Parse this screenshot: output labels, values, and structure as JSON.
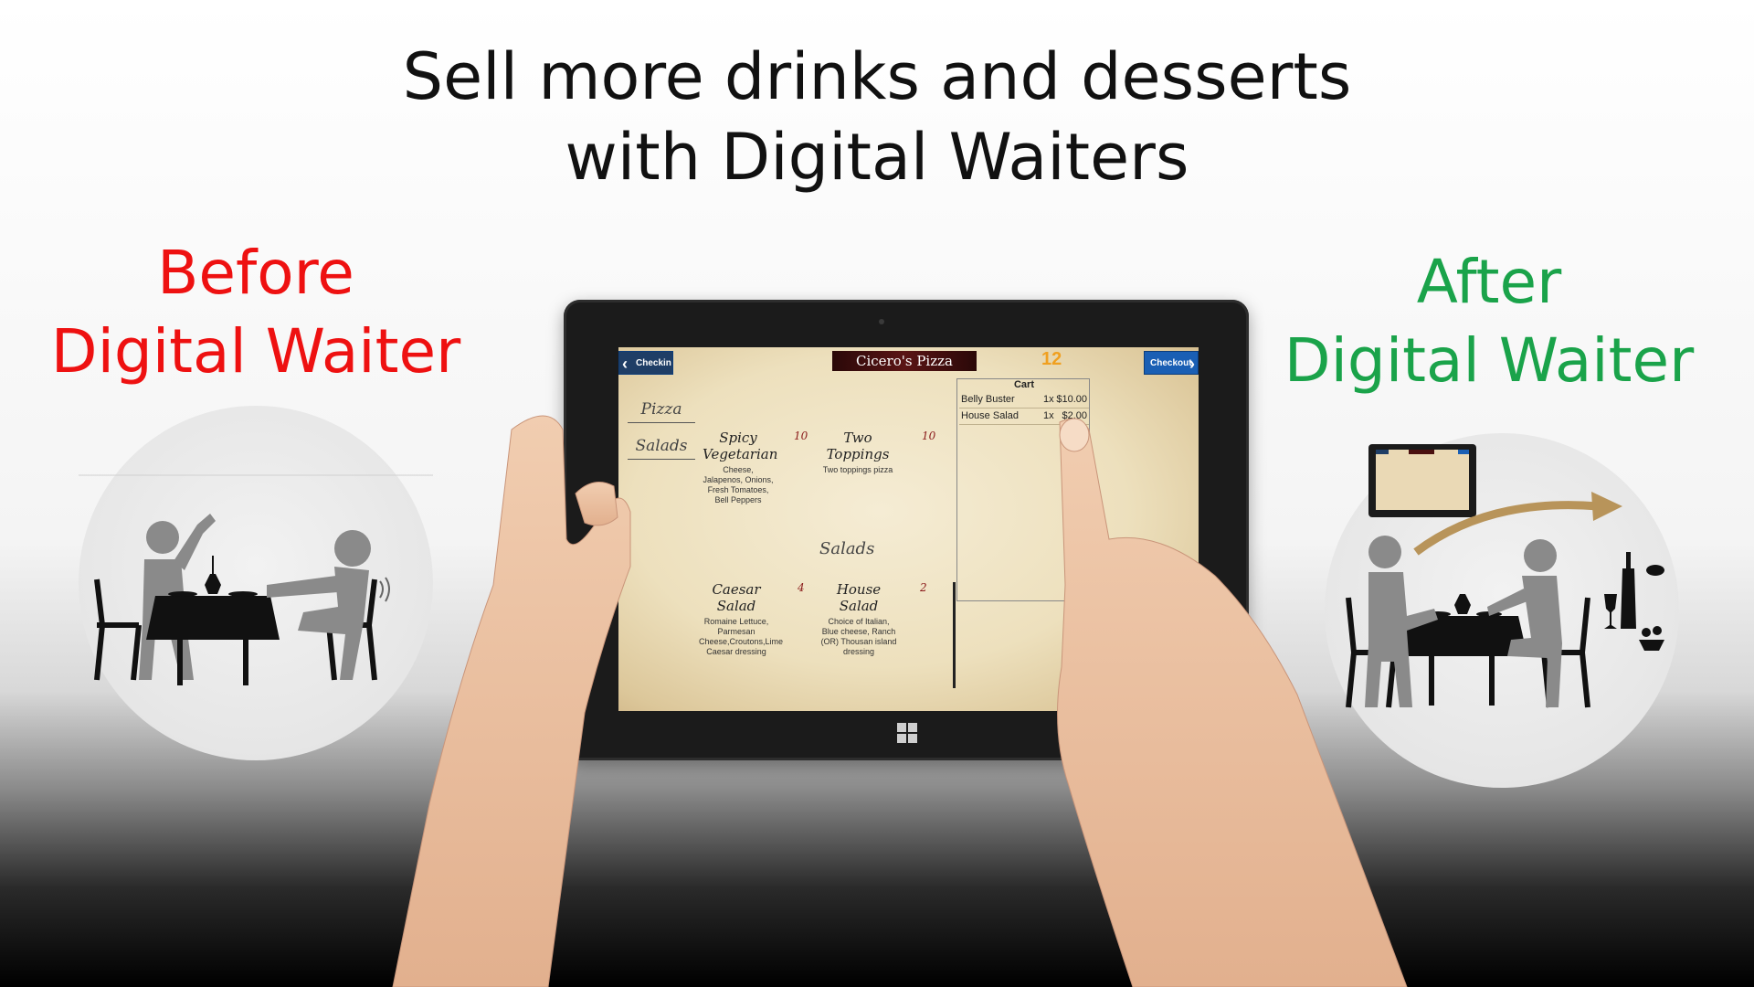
{
  "headline": [
    "Sell more drinks and desserts",
    "with Digital Waiters"
  ],
  "before": {
    "line1": "Before",
    "line2": "Digital Waiter"
  },
  "after": {
    "line1": "After",
    "line2": "Digital Waiter"
  },
  "app": {
    "checkin_label": "Checkin",
    "checkout_label": "Checkout",
    "restaurant_name": "Cicero's Pizza",
    "table_number": "12",
    "categories": [
      "Pizza",
      "Salads"
    ],
    "section_heading": "Salads",
    "items": [
      {
        "name": "Spicy Vegetarian",
        "price": "10",
        "description": "Cheese, Jalapenos, Onions, Fresh Tomatoes, Bell Peppers"
      },
      {
        "name": "Two Toppings",
        "price": "10",
        "description": "Two toppings pizza"
      },
      {
        "name": "Caesar Salad",
        "price": "4",
        "description": "Romaine Lettuce, Parmesan Cheese,Croutons,Lime Caesar dressing"
      },
      {
        "name": "House Salad",
        "price": "2",
        "description": "Choice of Italian, Blue cheese, Ranch (OR) Thousan island dressing"
      }
    ],
    "cart": {
      "title": "Cart",
      "rows": [
        {
          "name": "Belly Buster",
          "qty": "1x",
          "price": "$10.00"
        },
        {
          "name": "House Salad",
          "qty": "1x",
          "price": "$2.00"
        }
      ]
    }
  },
  "colors": {
    "before": "#ee1111",
    "after": "#1aa34a",
    "button": "#1a5fb4",
    "arrow": "#b8945a"
  },
  "icons": [
    "windows-logo-icon",
    "chevron-left-icon",
    "chevron-right-icon",
    "wine-bottle-icon",
    "wine-glass-icon",
    "dessert-icon"
  ]
}
